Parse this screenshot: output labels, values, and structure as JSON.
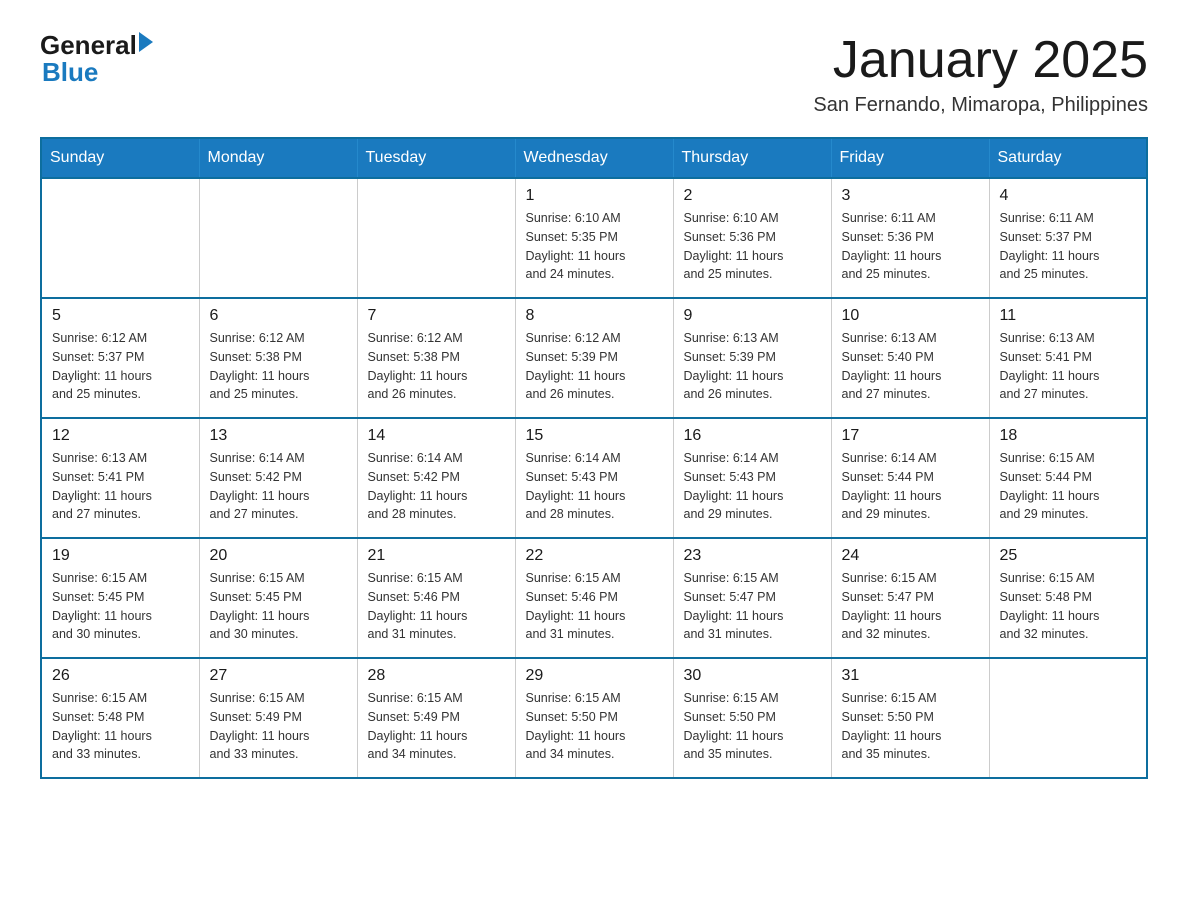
{
  "logo": {
    "general": "General",
    "blue": "Blue"
  },
  "title": "January 2025",
  "location": "San Fernando, Mimaropa, Philippines",
  "headers": [
    "Sunday",
    "Monday",
    "Tuesday",
    "Wednesday",
    "Thursday",
    "Friday",
    "Saturday"
  ],
  "weeks": [
    [
      {
        "day": "",
        "info": ""
      },
      {
        "day": "",
        "info": ""
      },
      {
        "day": "",
        "info": ""
      },
      {
        "day": "1",
        "info": "Sunrise: 6:10 AM\nSunset: 5:35 PM\nDaylight: 11 hours\nand 24 minutes."
      },
      {
        "day": "2",
        "info": "Sunrise: 6:10 AM\nSunset: 5:36 PM\nDaylight: 11 hours\nand 25 minutes."
      },
      {
        "day": "3",
        "info": "Sunrise: 6:11 AM\nSunset: 5:36 PM\nDaylight: 11 hours\nand 25 minutes."
      },
      {
        "day": "4",
        "info": "Sunrise: 6:11 AM\nSunset: 5:37 PM\nDaylight: 11 hours\nand 25 minutes."
      }
    ],
    [
      {
        "day": "5",
        "info": "Sunrise: 6:12 AM\nSunset: 5:37 PM\nDaylight: 11 hours\nand 25 minutes."
      },
      {
        "day": "6",
        "info": "Sunrise: 6:12 AM\nSunset: 5:38 PM\nDaylight: 11 hours\nand 25 minutes."
      },
      {
        "day": "7",
        "info": "Sunrise: 6:12 AM\nSunset: 5:38 PM\nDaylight: 11 hours\nand 26 minutes."
      },
      {
        "day": "8",
        "info": "Sunrise: 6:12 AM\nSunset: 5:39 PM\nDaylight: 11 hours\nand 26 minutes."
      },
      {
        "day": "9",
        "info": "Sunrise: 6:13 AM\nSunset: 5:39 PM\nDaylight: 11 hours\nand 26 minutes."
      },
      {
        "day": "10",
        "info": "Sunrise: 6:13 AM\nSunset: 5:40 PM\nDaylight: 11 hours\nand 27 minutes."
      },
      {
        "day": "11",
        "info": "Sunrise: 6:13 AM\nSunset: 5:41 PM\nDaylight: 11 hours\nand 27 minutes."
      }
    ],
    [
      {
        "day": "12",
        "info": "Sunrise: 6:13 AM\nSunset: 5:41 PM\nDaylight: 11 hours\nand 27 minutes."
      },
      {
        "day": "13",
        "info": "Sunrise: 6:14 AM\nSunset: 5:42 PM\nDaylight: 11 hours\nand 27 minutes."
      },
      {
        "day": "14",
        "info": "Sunrise: 6:14 AM\nSunset: 5:42 PM\nDaylight: 11 hours\nand 28 minutes."
      },
      {
        "day": "15",
        "info": "Sunrise: 6:14 AM\nSunset: 5:43 PM\nDaylight: 11 hours\nand 28 minutes."
      },
      {
        "day": "16",
        "info": "Sunrise: 6:14 AM\nSunset: 5:43 PM\nDaylight: 11 hours\nand 29 minutes."
      },
      {
        "day": "17",
        "info": "Sunrise: 6:14 AM\nSunset: 5:44 PM\nDaylight: 11 hours\nand 29 minutes."
      },
      {
        "day": "18",
        "info": "Sunrise: 6:15 AM\nSunset: 5:44 PM\nDaylight: 11 hours\nand 29 minutes."
      }
    ],
    [
      {
        "day": "19",
        "info": "Sunrise: 6:15 AM\nSunset: 5:45 PM\nDaylight: 11 hours\nand 30 minutes."
      },
      {
        "day": "20",
        "info": "Sunrise: 6:15 AM\nSunset: 5:45 PM\nDaylight: 11 hours\nand 30 minutes."
      },
      {
        "day": "21",
        "info": "Sunrise: 6:15 AM\nSunset: 5:46 PM\nDaylight: 11 hours\nand 31 minutes."
      },
      {
        "day": "22",
        "info": "Sunrise: 6:15 AM\nSunset: 5:46 PM\nDaylight: 11 hours\nand 31 minutes."
      },
      {
        "day": "23",
        "info": "Sunrise: 6:15 AM\nSunset: 5:47 PM\nDaylight: 11 hours\nand 31 minutes."
      },
      {
        "day": "24",
        "info": "Sunrise: 6:15 AM\nSunset: 5:47 PM\nDaylight: 11 hours\nand 32 minutes."
      },
      {
        "day": "25",
        "info": "Sunrise: 6:15 AM\nSunset: 5:48 PM\nDaylight: 11 hours\nand 32 minutes."
      }
    ],
    [
      {
        "day": "26",
        "info": "Sunrise: 6:15 AM\nSunset: 5:48 PM\nDaylight: 11 hours\nand 33 minutes."
      },
      {
        "day": "27",
        "info": "Sunrise: 6:15 AM\nSunset: 5:49 PM\nDaylight: 11 hours\nand 33 minutes."
      },
      {
        "day": "28",
        "info": "Sunrise: 6:15 AM\nSunset: 5:49 PM\nDaylight: 11 hours\nand 34 minutes."
      },
      {
        "day": "29",
        "info": "Sunrise: 6:15 AM\nSunset: 5:50 PM\nDaylight: 11 hours\nand 34 minutes."
      },
      {
        "day": "30",
        "info": "Sunrise: 6:15 AM\nSunset: 5:50 PM\nDaylight: 11 hours\nand 35 minutes."
      },
      {
        "day": "31",
        "info": "Sunrise: 6:15 AM\nSunset: 5:50 PM\nDaylight: 11 hours\nand 35 minutes."
      },
      {
        "day": "",
        "info": ""
      }
    ]
  ]
}
